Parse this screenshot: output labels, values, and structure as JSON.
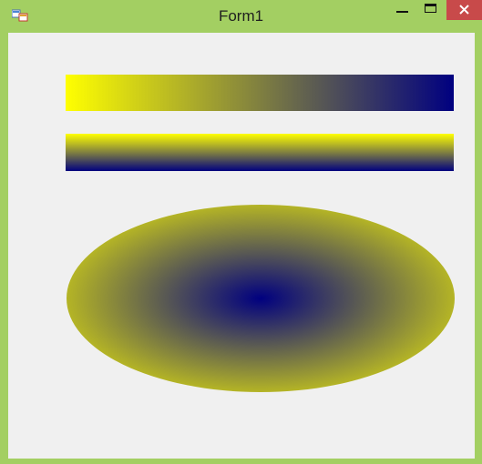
{
  "window": {
    "title": "Form1"
  },
  "icons": {
    "app": "app-icon",
    "minimize": "minimize-icon",
    "maximize": "maximize-icon",
    "close": "close-icon"
  },
  "colors": {
    "frame": "#a3cf62",
    "client_bg": "#f0f0f0",
    "close_button": "#c84a4a",
    "gradient_start": "#ffff00",
    "gradient_end": "#000080"
  },
  "shapes": [
    {
      "kind": "rectangle",
      "gradient": "linear",
      "direction": "left-to-right",
      "from": "#ffff00",
      "to": "#000080"
    },
    {
      "kind": "rectangle",
      "gradient": "linear",
      "direction": "top-to-bottom",
      "from": "#ffff00",
      "to": "#000080"
    },
    {
      "kind": "ellipse",
      "gradient": "radial",
      "center": "#000080",
      "edge": "#ffff00"
    }
  ]
}
